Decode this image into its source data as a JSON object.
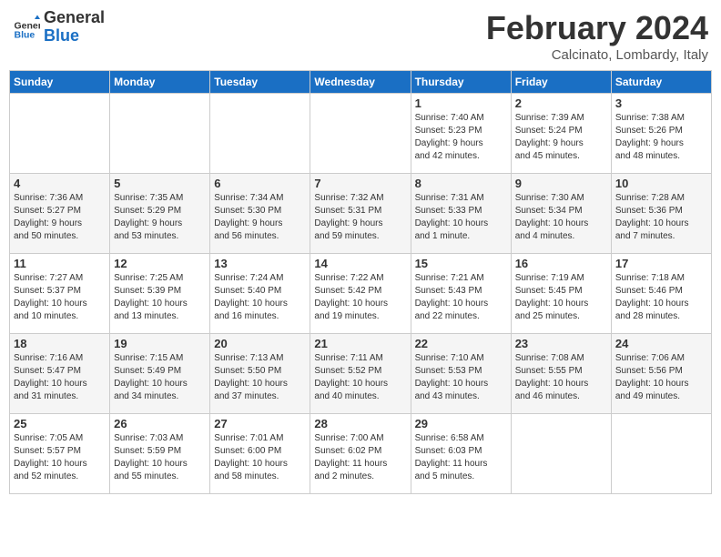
{
  "header": {
    "logo_line1": "General",
    "logo_line2": "Blue",
    "month": "February 2024",
    "location": "Calcinato, Lombardy, Italy"
  },
  "weekdays": [
    "Sunday",
    "Monday",
    "Tuesday",
    "Wednesday",
    "Thursday",
    "Friday",
    "Saturday"
  ],
  "weeks": [
    [
      {
        "day": "",
        "info": ""
      },
      {
        "day": "",
        "info": ""
      },
      {
        "day": "",
        "info": ""
      },
      {
        "day": "",
        "info": ""
      },
      {
        "day": "1",
        "info": "Sunrise: 7:40 AM\nSunset: 5:23 PM\nDaylight: 9 hours\nand 42 minutes."
      },
      {
        "day": "2",
        "info": "Sunrise: 7:39 AM\nSunset: 5:24 PM\nDaylight: 9 hours\nand 45 minutes."
      },
      {
        "day": "3",
        "info": "Sunrise: 7:38 AM\nSunset: 5:26 PM\nDaylight: 9 hours\nand 48 minutes."
      }
    ],
    [
      {
        "day": "4",
        "info": "Sunrise: 7:36 AM\nSunset: 5:27 PM\nDaylight: 9 hours\nand 50 minutes."
      },
      {
        "day": "5",
        "info": "Sunrise: 7:35 AM\nSunset: 5:29 PM\nDaylight: 9 hours\nand 53 minutes."
      },
      {
        "day": "6",
        "info": "Sunrise: 7:34 AM\nSunset: 5:30 PM\nDaylight: 9 hours\nand 56 minutes."
      },
      {
        "day": "7",
        "info": "Sunrise: 7:32 AM\nSunset: 5:31 PM\nDaylight: 9 hours\nand 59 minutes."
      },
      {
        "day": "8",
        "info": "Sunrise: 7:31 AM\nSunset: 5:33 PM\nDaylight: 10 hours\nand 1 minute."
      },
      {
        "day": "9",
        "info": "Sunrise: 7:30 AM\nSunset: 5:34 PM\nDaylight: 10 hours\nand 4 minutes."
      },
      {
        "day": "10",
        "info": "Sunrise: 7:28 AM\nSunset: 5:36 PM\nDaylight: 10 hours\nand 7 minutes."
      }
    ],
    [
      {
        "day": "11",
        "info": "Sunrise: 7:27 AM\nSunset: 5:37 PM\nDaylight: 10 hours\nand 10 minutes."
      },
      {
        "day": "12",
        "info": "Sunrise: 7:25 AM\nSunset: 5:39 PM\nDaylight: 10 hours\nand 13 minutes."
      },
      {
        "day": "13",
        "info": "Sunrise: 7:24 AM\nSunset: 5:40 PM\nDaylight: 10 hours\nand 16 minutes."
      },
      {
        "day": "14",
        "info": "Sunrise: 7:22 AM\nSunset: 5:42 PM\nDaylight: 10 hours\nand 19 minutes."
      },
      {
        "day": "15",
        "info": "Sunrise: 7:21 AM\nSunset: 5:43 PM\nDaylight: 10 hours\nand 22 minutes."
      },
      {
        "day": "16",
        "info": "Sunrise: 7:19 AM\nSunset: 5:45 PM\nDaylight: 10 hours\nand 25 minutes."
      },
      {
        "day": "17",
        "info": "Sunrise: 7:18 AM\nSunset: 5:46 PM\nDaylight: 10 hours\nand 28 minutes."
      }
    ],
    [
      {
        "day": "18",
        "info": "Sunrise: 7:16 AM\nSunset: 5:47 PM\nDaylight: 10 hours\nand 31 minutes."
      },
      {
        "day": "19",
        "info": "Sunrise: 7:15 AM\nSunset: 5:49 PM\nDaylight: 10 hours\nand 34 minutes."
      },
      {
        "day": "20",
        "info": "Sunrise: 7:13 AM\nSunset: 5:50 PM\nDaylight: 10 hours\nand 37 minutes."
      },
      {
        "day": "21",
        "info": "Sunrise: 7:11 AM\nSunset: 5:52 PM\nDaylight: 10 hours\nand 40 minutes."
      },
      {
        "day": "22",
        "info": "Sunrise: 7:10 AM\nSunset: 5:53 PM\nDaylight: 10 hours\nand 43 minutes."
      },
      {
        "day": "23",
        "info": "Sunrise: 7:08 AM\nSunset: 5:55 PM\nDaylight: 10 hours\nand 46 minutes."
      },
      {
        "day": "24",
        "info": "Sunrise: 7:06 AM\nSunset: 5:56 PM\nDaylight: 10 hours\nand 49 minutes."
      }
    ],
    [
      {
        "day": "25",
        "info": "Sunrise: 7:05 AM\nSunset: 5:57 PM\nDaylight: 10 hours\nand 52 minutes."
      },
      {
        "day": "26",
        "info": "Sunrise: 7:03 AM\nSunset: 5:59 PM\nDaylight: 10 hours\nand 55 minutes."
      },
      {
        "day": "27",
        "info": "Sunrise: 7:01 AM\nSunset: 6:00 PM\nDaylight: 10 hours\nand 58 minutes."
      },
      {
        "day": "28",
        "info": "Sunrise: 7:00 AM\nSunset: 6:02 PM\nDaylight: 11 hours\nand 2 minutes."
      },
      {
        "day": "29",
        "info": "Sunrise: 6:58 AM\nSunset: 6:03 PM\nDaylight: 11 hours\nand 5 minutes."
      },
      {
        "day": "",
        "info": ""
      },
      {
        "day": "",
        "info": ""
      }
    ]
  ]
}
